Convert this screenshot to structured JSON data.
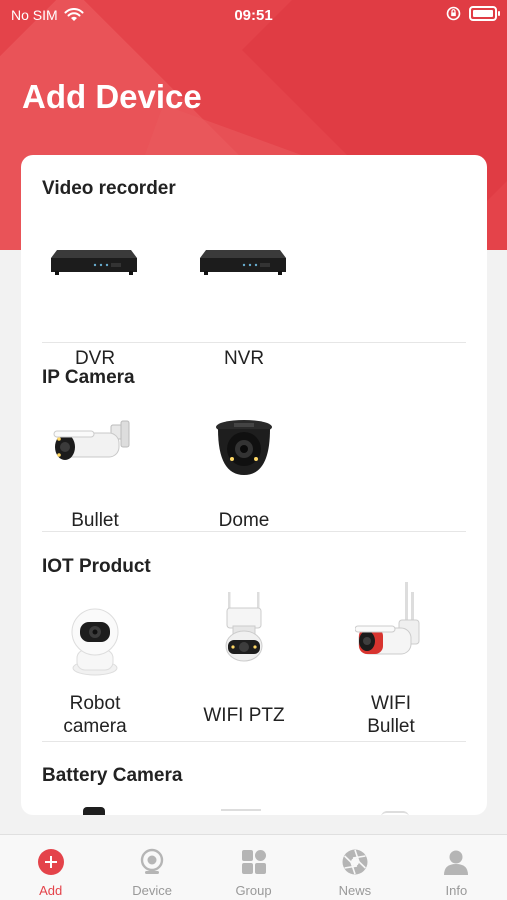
{
  "status_bar": {
    "carrier": "No SIM",
    "time": "09:51"
  },
  "page_title": "Add Device",
  "sections": [
    {
      "title": "Video recorder",
      "items": [
        {
          "label": "DVR",
          "icon": "dvr-device-icon"
        },
        {
          "label": "NVR",
          "icon": "nvr-device-icon"
        }
      ]
    },
    {
      "title": "IP Camera",
      "items": [
        {
          "label": "Bullet",
          "icon": "bullet-camera-icon"
        },
        {
          "label": "Dome",
          "icon": "dome-camera-icon"
        }
      ]
    },
    {
      "title": "IOT Product",
      "items": [
        {
          "label": "Robot\ncamera",
          "line1": "Robot",
          "line2": "camera",
          "icon": "robot-camera-icon"
        },
        {
          "label": "WIFI PTZ",
          "icon": "wifi-ptz-icon"
        },
        {
          "label": "WIFI\nBullet",
          "line1": "WIFI",
          "line2": "Bullet",
          "icon": "wifi-bullet-icon"
        }
      ]
    },
    {
      "title": "Battery Camera",
      "items": []
    }
  ],
  "bottom_nav": [
    {
      "label": "Add",
      "icon": "add-icon",
      "active": true
    },
    {
      "label": "Device",
      "icon": "device-icon",
      "active": false
    },
    {
      "label": "Group",
      "icon": "group-icon",
      "active": false
    },
    {
      "label": "News",
      "icon": "news-icon",
      "active": false
    },
    {
      "label": "Info",
      "icon": "info-icon",
      "active": false
    }
  ],
  "colors": {
    "accent": "#e4434a",
    "nav_inactive": "#999999",
    "text": "#222222"
  }
}
